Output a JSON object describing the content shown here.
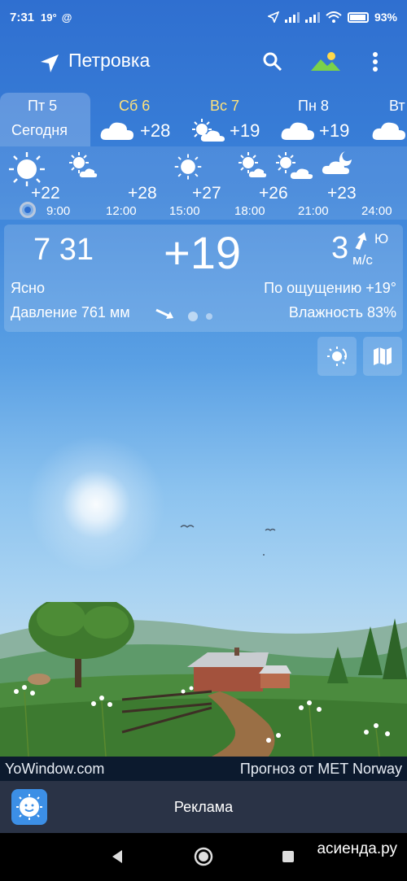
{
  "status_bar": {
    "time": "7:31",
    "small_temp": "19°",
    "at_symbol": "@",
    "battery": "93%"
  },
  "header": {
    "city": "Петровка",
    "icons": [
      "location-arrow-icon",
      "search-icon",
      "landscape-icon",
      "more-vert-icon"
    ]
  },
  "days": [
    {
      "name": "Пт 5",
      "sub": "Сегодня",
      "temp": "",
      "icon": ""
    },
    {
      "name": "Сб 6",
      "temp": "+28",
      "icon": "cloudy-icon"
    },
    {
      "name": "Вс 7",
      "temp": "+19",
      "icon": "partly-cloudy-icon"
    },
    {
      "name": "Пн 8",
      "temp": "+19",
      "icon": "cloudy-icon"
    },
    {
      "name": "Вт",
      "temp": "",
      "icon": "cloudy-icon"
    }
  ],
  "hourly": [
    {
      "time": "9:00",
      "temp": "+22",
      "icon": "sun-icon"
    },
    {
      "time": "12:00",
      "temp": "+28",
      "icon": "sun-cloud-icon"
    },
    {
      "time": "15:00",
      "temp": "+27",
      "icon": "sun-icon"
    },
    {
      "time": "18:00",
      "temp": "+26",
      "icon": "sun-cloud-icon"
    },
    {
      "time": "21:00",
      "temp": "+23",
      "icon": "sun-cloud-icon"
    },
    {
      "time": "24:00",
      "temp": "",
      "icon": "moon-cloud-icon"
    }
  ],
  "current": {
    "time": "7 31",
    "temp": "+19",
    "wind_speed": "3",
    "wind_unit": "м/с",
    "wind_dir": "Ю",
    "condition": "Ясно",
    "feels_like": "По ощущению +19°",
    "pressure": "Давление 761 мм",
    "humidity": "Влажность 83%"
  },
  "credits": {
    "left": "YoWindow.com",
    "right": "Прогноз от MET Norway"
  },
  "ad": {
    "label": "Реклама"
  },
  "watermark": "асиенда.ру",
  "colors": {
    "sky_top": "#2f6fd0",
    "weekend": "#ffe27a",
    "credits_bg": "#0c1a2e",
    "ad_bg": "#2a3346"
  }
}
